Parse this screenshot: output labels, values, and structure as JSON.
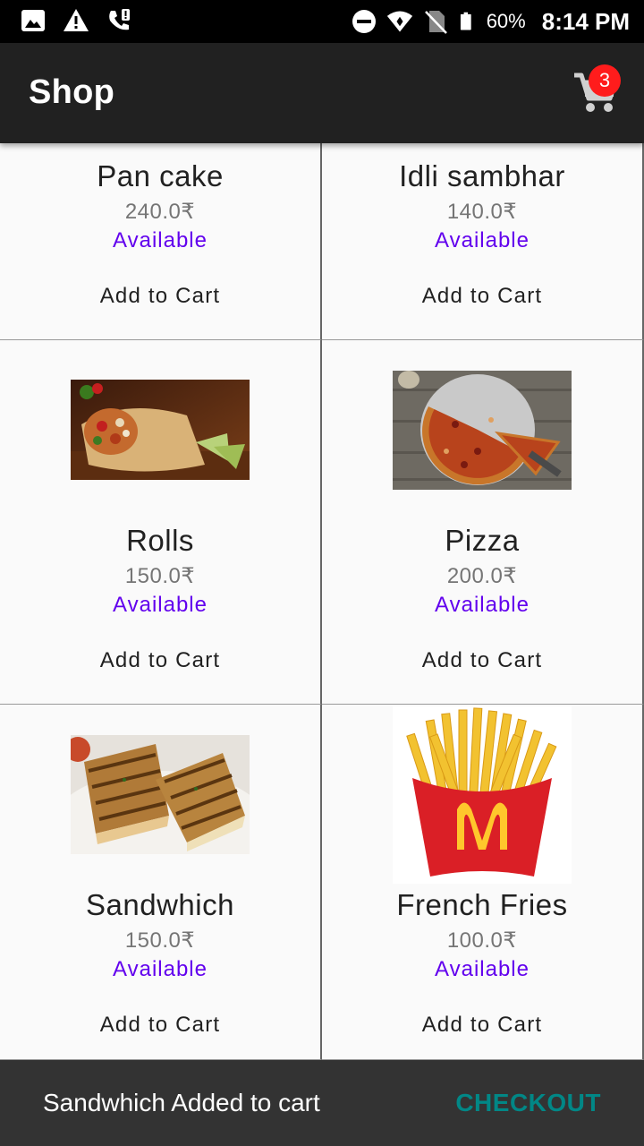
{
  "status_bar": {
    "battery_percent": "60%",
    "time": "8:14 PM",
    "icons": [
      "image-icon",
      "warning-icon",
      "wifi-call-icon",
      "do-not-disturb-icon",
      "wifi-icon",
      "no-sim-icon",
      "battery-icon"
    ]
  },
  "app_bar": {
    "title": "Shop",
    "cart_count": "3"
  },
  "products": [
    {
      "name": "Pan cake",
      "price": "240.0₹",
      "status": "Available",
      "button": "Add to Cart",
      "image": "none"
    },
    {
      "name": "Idli sambhar",
      "price": "140.0₹",
      "status": "Available",
      "button": "Add to Cart",
      "image": "none"
    },
    {
      "name": "Rolls",
      "price": "150.0₹",
      "status": "Available",
      "button": "Add to Cart",
      "image": "wrap-roll-image"
    },
    {
      "name": "Pizza",
      "price": "200.0₹",
      "status": "Available",
      "button": "Add to Cart",
      "image": "pizza-image"
    },
    {
      "name": "Sandwhich",
      "price": "150.0₹",
      "status": "Available",
      "button": "Add to Cart",
      "image": "grilled-sandwich-image"
    },
    {
      "name": "French Fries",
      "price": "100.0₹",
      "status": "Available",
      "button": "Add to Cart",
      "image": "french-fries-image"
    }
  ],
  "snackbar": {
    "message": "Sandwhich Added to cart",
    "action": "CHECKOUT"
  },
  "colors": {
    "app_bar": "#212121",
    "available": "#6200ee",
    "checkout": "#018786",
    "badge": "#ff1c1c"
  }
}
